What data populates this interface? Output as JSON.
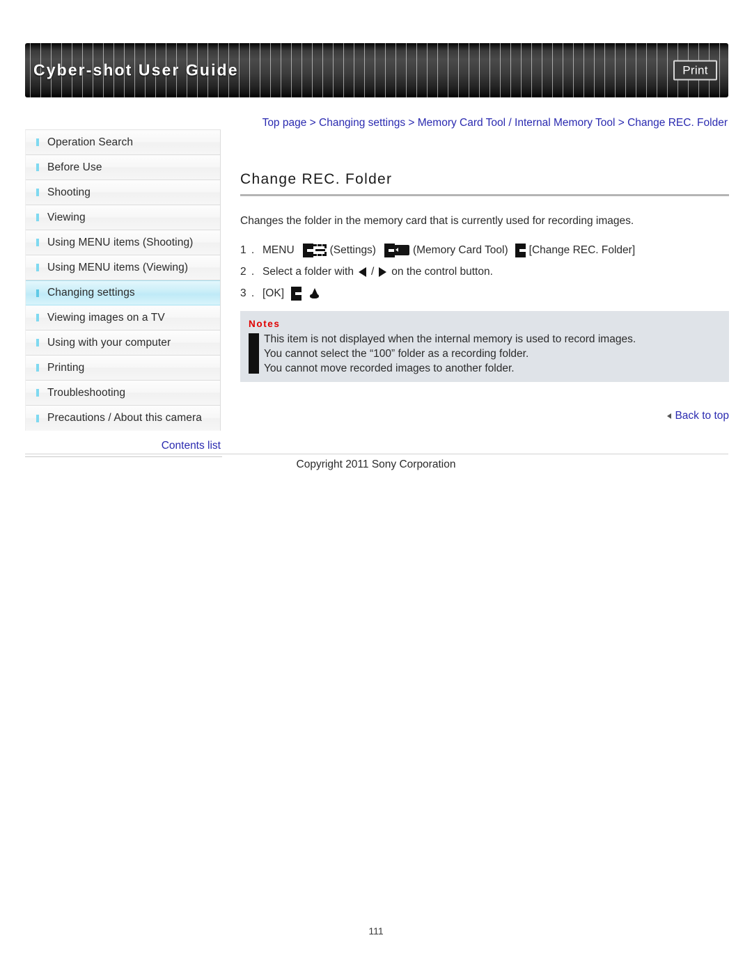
{
  "header": {
    "title": "Cyber-shot User Guide",
    "print_label": "Print"
  },
  "breadcrumb": {
    "text": "Top page > Changing settings > Memory Card Tool / Internal Memory Tool > Change REC. Folder"
  },
  "sidebar": {
    "items": [
      {
        "label": "Operation Search",
        "active": false
      },
      {
        "label": "Before Use",
        "active": false
      },
      {
        "label": "Shooting",
        "active": false
      },
      {
        "label": "Viewing",
        "active": false
      },
      {
        "label": "Using MENU items (Shooting)",
        "active": false
      },
      {
        "label": "Using MENU items (Viewing)",
        "active": false
      },
      {
        "label": "Changing settings",
        "active": true
      },
      {
        "label": "Viewing images on a TV",
        "active": false
      },
      {
        "label": "Using with your computer",
        "active": false
      },
      {
        "label": "Printing",
        "active": false
      },
      {
        "label": "Troubleshooting",
        "active": false
      },
      {
        "label": "Precautions / About this camera",
        "active": false
      }
    ],
    "contents_link": "Contents list"
  },
  "main": {
    "title": "Change REC. Folder",
    "intro": "Changes the folder in the memory card that is currently used for recording images.",
    "steps": [
      {
        "num": "1 .",
        "parts": [
          {
            "type": "text",
            "value": "MENU"
          },
          {
            "type": "icon",
            "value": "settings-menu-icon"
          },
          {
            "type": "text",
            "value": "(Settings)"
          },
          {
            "type": "icon",
            "value": "memory-card-tool-icon"
          },
          {
            "type": "text",
            "value": "(Memory Card Tool)"
          },
          {
            "type": "icon",
            "value": "select-bracket-icon"
          },
          {
            "type": "text",
            "value": "[Change REC. Folder]"
          }
        ]
      },
      {
        "num": "2 .",
        "parts": [
          {
            "type": "text",
            "value": "Select a folder with"
          },
          {
            "type": "icon",
            "value": "arrow-left-icon"
          },
          {
            "type": "text",
            "value": "/"
          },
          {
            "type": "icon",
            "value": "arrow-right-icon"
          },
          {
            "type": "text",
            "value": "on the control button."
          }
        ]
      },
      {
        "num": "3 .",
        "parts": [
          {
            "type": "text",
            "value": "[OK]"
          },
          {
            "type": "icon",
            "value": "select-bracket-icon"
          },
          {
            "type": "icon",
            "value": "confirm-drop-icon"
          }
        ]
      }
    ]
  },
  "notes": {
    "title": "Notes",
    "lines": [
      "This item is not displayed when the internal memory is used to record images.",
      "You cannot select the “100” folder as a recording folder.",
      "You cannot move recorded images to another folder."
    ]
  },
  "back_to_top": "Back to top",
  "footer": {
    "copyright": "Copyright 2011 Sony Corporation",
    "page_number": "111"
  },
  "colors": {
    "link": "#2a2ab0",
    "notes_title": "#e00000",
    "notes_background": "#dfe3e8",
    "sidebar_active": "#c9eef8",
    "bullet": "#7fd9f0"
  }
}
